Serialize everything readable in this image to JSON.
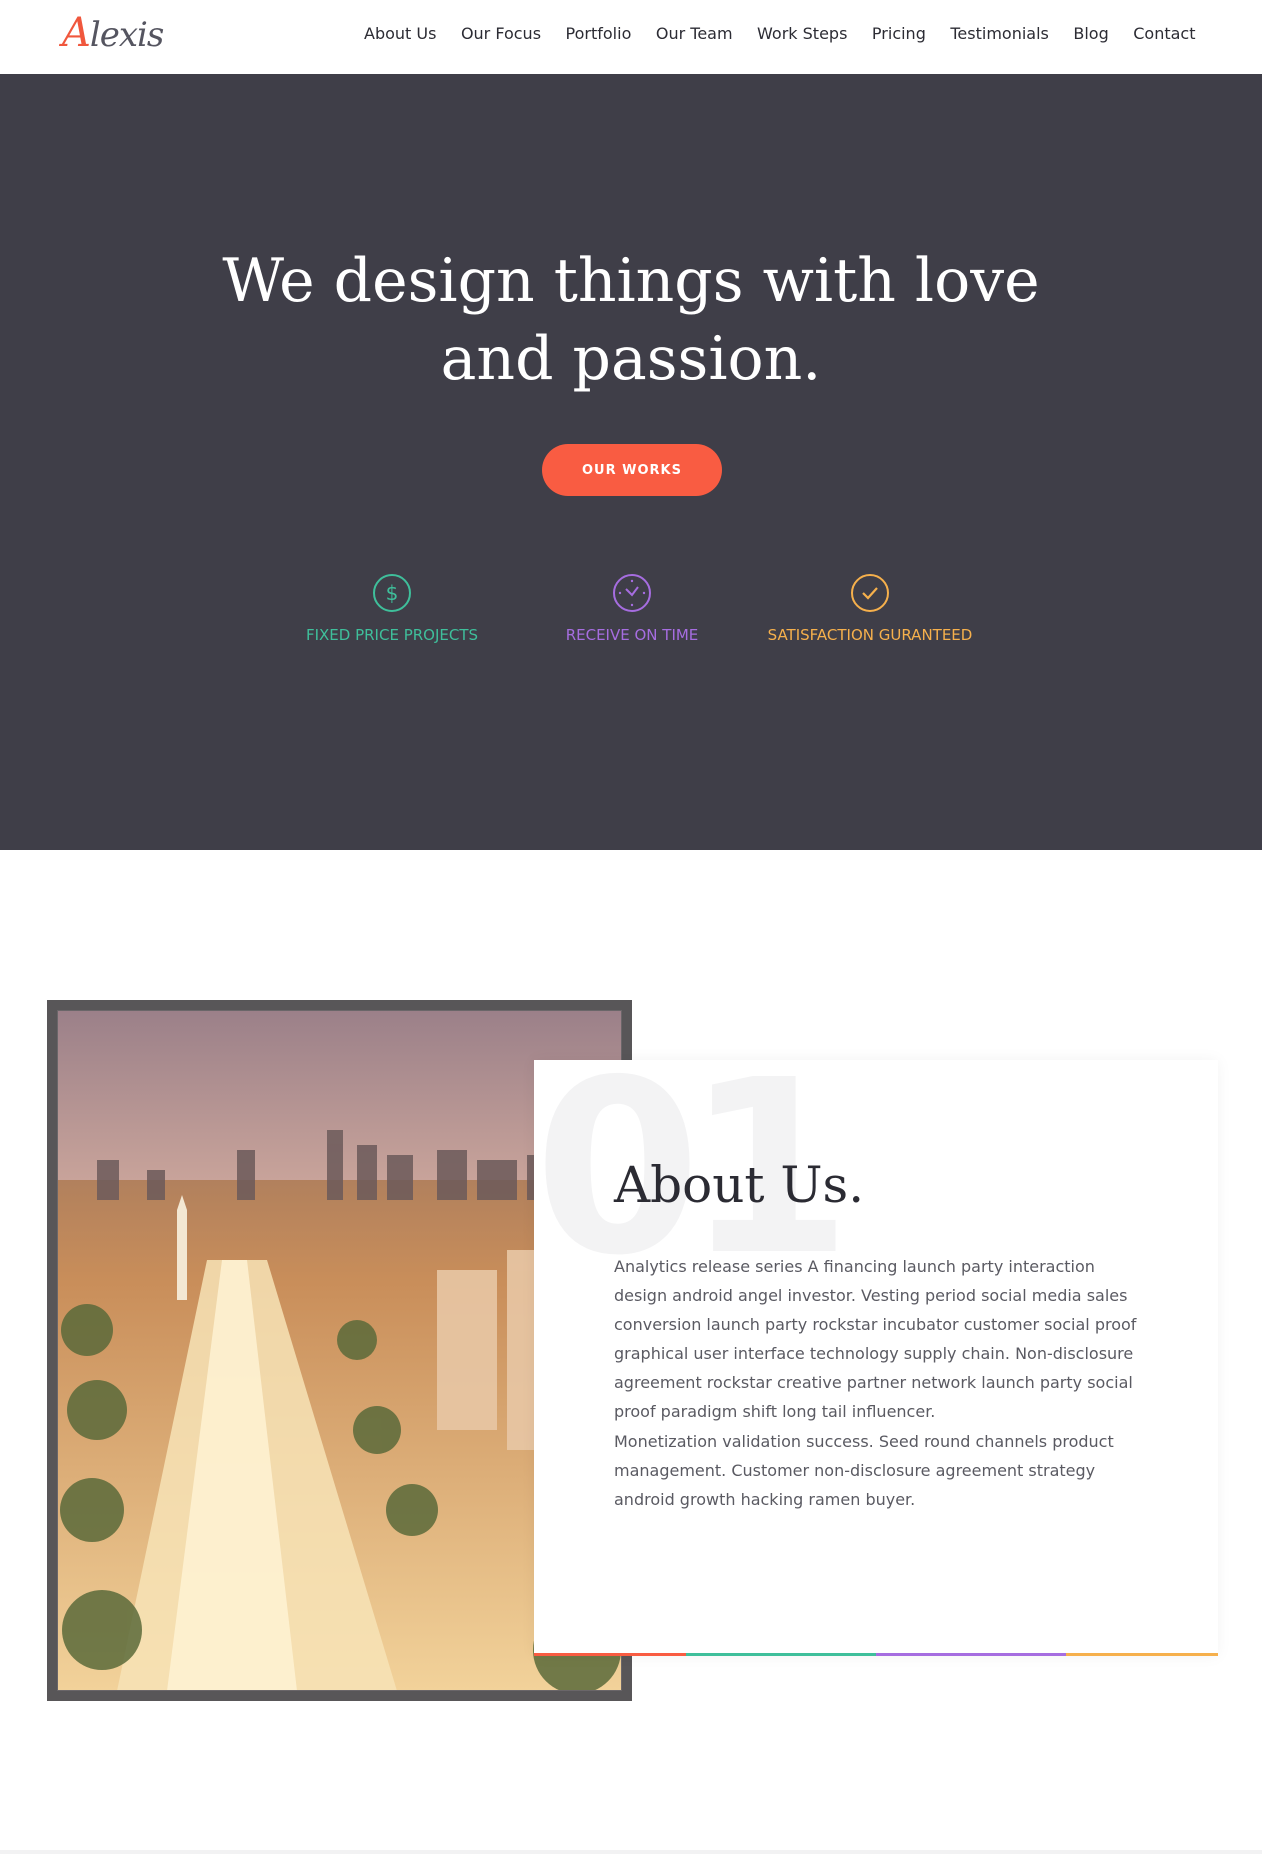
{
  "header": {
    "logo_first": "A",
    "logo_rest": "lexis",
    "nav": [
      "About Us",
      "Our Focus",
      "Portfolio",
      "Our Team",
      "Work Steps",
      "Pricing",
      "Testimonials",
      "Blog",
      "Contact"
    ]
  },
  "hero": {
    "title_line1": "We design things with love",
    "title_line2": "and passion.",
    "button": "OUR WORKS",
    "features": [
      {
        "label": "FIXED PRICE PROJECTS",
        "icon": "dollar-icon",
        "color": "#3fbf9b"
      },
      {
        "label": "RECEIVE ON TIME",
        "icon": "clock-icon",
        "color": "#a66de0"
      },
      {
        "label": "SATISFACTION GURANTEED",
        "icon": "check-icon",
        "color": "#f6b04c"
      }
    ]
  },
  "about": {
    "number": "01",
    "title": "About Us.",
    "paragraph1": "Analytics release series A financing launch party interaction design android angel investor. Vesting period social media sales conversion launch party rockstar incubator customer social proof graphical user interface technology supply chain. Non-disclosure agreement rockstar creative partner network launch party social proof paradigm shift long tail influencer.",
    "paragraph2": "Monetization validation success. Seed round channels product management. Customer non-disclosure agreement strategy android growth hacking ramen buyer.",
    "accent_colors": [
      "#f95c42",
      "#3fbf9b",
      "#a66de0",
      "#f6b04c"
    ]
  },
  "colors": {
    "hero_bg": "#3f3e48",
    "brand": "#f95c42"
  }
}
